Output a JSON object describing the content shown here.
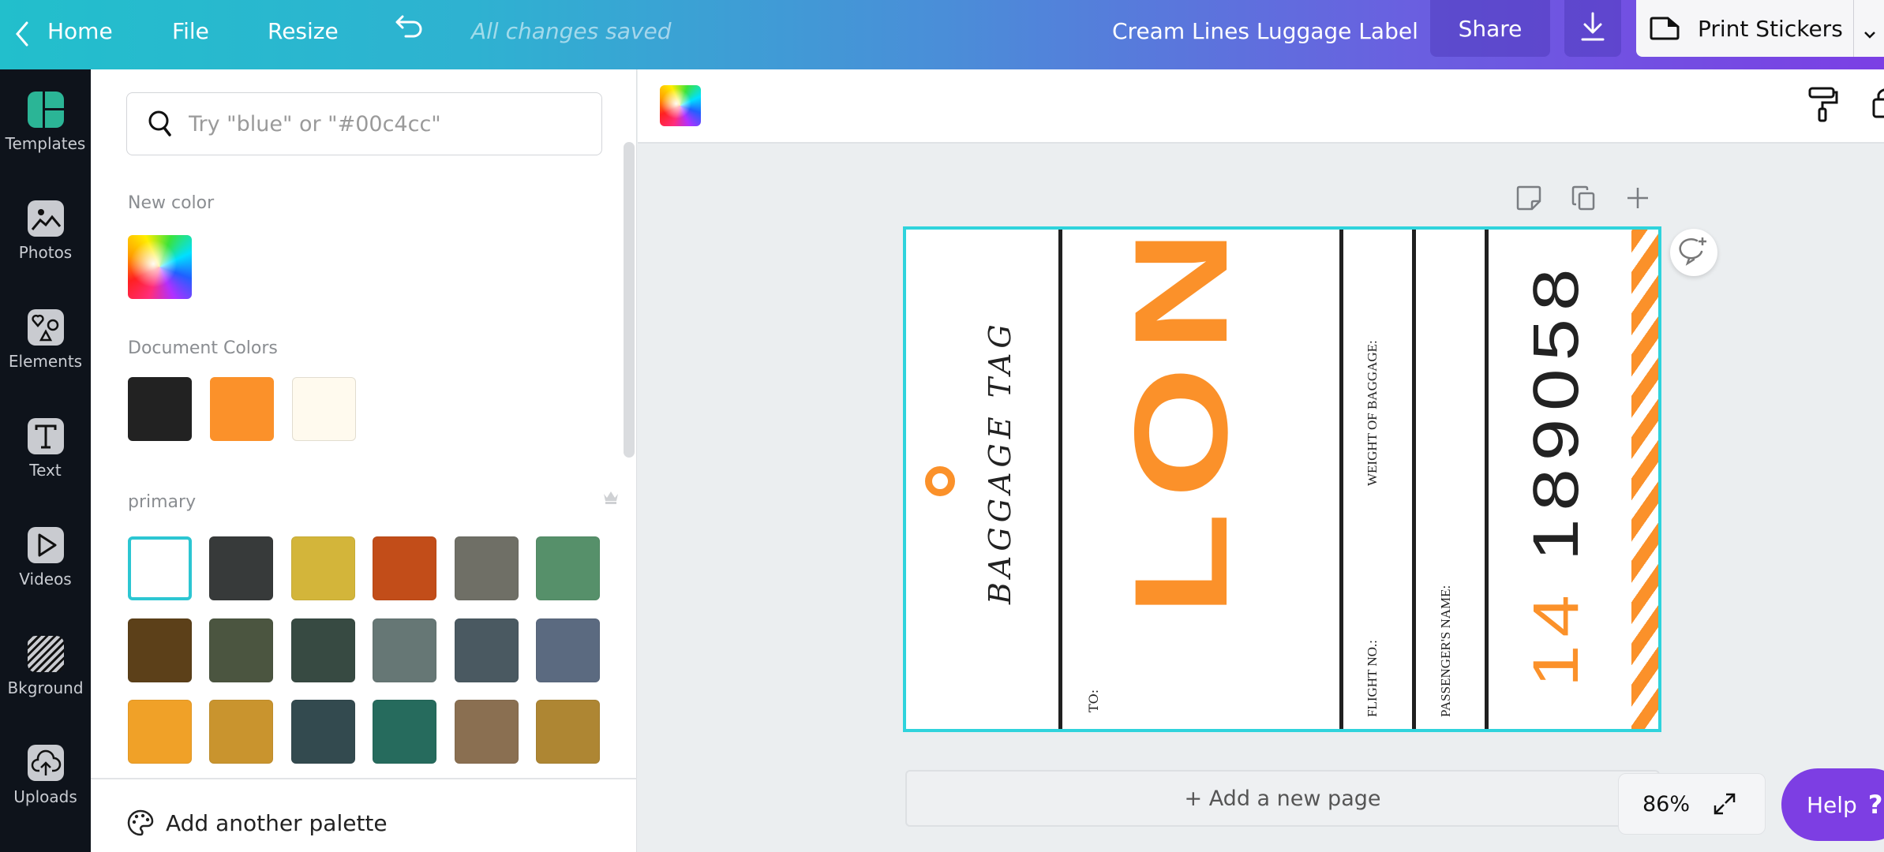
{
  "topbar": {
    "home_label": "Home",
    "file_label": "File",
    "resize_label": "Resize",
    "save_status": "All changes saved",
    "document_title": "Cream Lines Luggage Label",
    "share_label": "Share",
    "print_label": "Print Stickers"
  },
  "sidebar": {
    "items": [
      {
        "label": "Templates",
        "icon": "templates-icon"
      },
      {
        "label": "Photos",
        "icon": "photos-icon"
      },
      {
        "label": "Elements",
        "icon": "elements-icon"
      },
      {
        "label": "Text",
        "icon": "text-icon"
      },
      {
        "label": "Videos",
        "icon": "videos-icon"
      },
      {
        "label": "Bkground",
        "icon": "background-icon"
      },
      {
        "label": "Uploads",
        "icon": "uploads-icon"
      }
    ]
  },
  "color_panel": {
    "search_placeholder": "Try \"blue\" or \"#00c4cc\"",
    "new_color_label": "New color",
    "document_colors_label": "Document Colors",
    "document_colors": [
      "#222222",
      "#fb912a",
      "#fffaee"
    ],
    "palette_name": "primary",
    "palette_colors": [
      "#ffffff",
      "#373a3a",
      "#d3b53a",
      "#c24d19",
      "#6f6f66",
      "#56906a",
      "#5c4019",
      "#4b5540",
      "#374a42",
      "#667775",
      "#4a5961",
      "#5b6a80",
      "#f0a128",
      "#c9942e",
      "#334a4f",
      "#266b5d",
      "#8a6f51",
      "#ae8633"
    ],
    "selected_palette_index": 0,
    "add_palette_label": "Add another palette"
  },
  "design": {
    "title_text": "BAGGAGE TAG",
    "destination_label": "TO:",
    "destination_code": "LON",
    "weight_label": "WEIGHT OF BAGGAGE:",
    "flight_label": "FLIGHT NO.:",
    "passenger_label": "PASSENGER'S NAME:",
    "tag_prefix": "14",
    "tag_number": "189058",
    "accent_color": "#fb912a",
    "selection_color": "#2fd3dc"
  },
  "canvas": {
    "add_page_label": "+ Add a new page",
    "zoom_level": "86%",
    "help_label": "Help",
    "help_symbol": "?"
  }
}
